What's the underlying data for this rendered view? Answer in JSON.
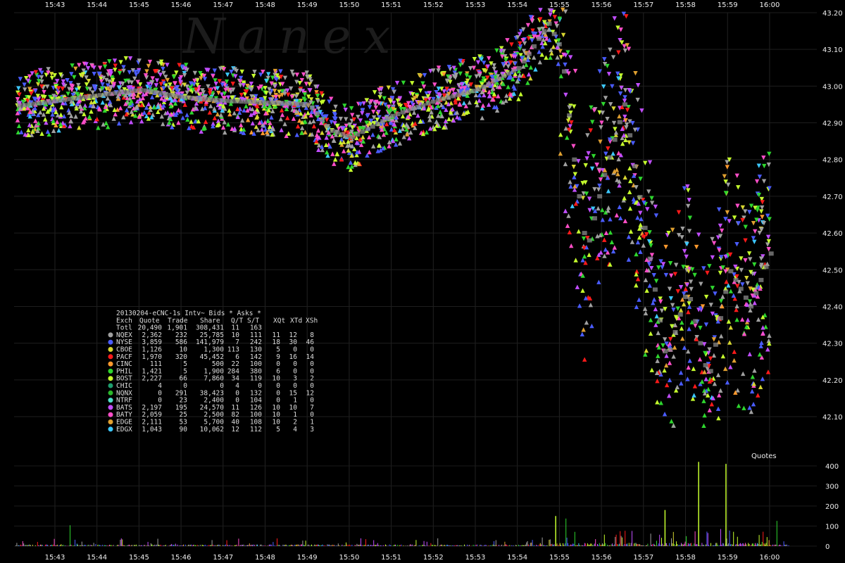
{
  "chart_data": {
    "type": "scatter",
    "title": "",
    "subtitle": "",
    "legend_title": "20130204-eCNC-1s Intv~ Bids * Asks *",
    "legend_placement": "left-center",
    "x_ticks": [
      "15:43",
      "15:44",
      "15:45",
      "15:46",
      "15:47",
      "15:48",
      "15:49",
      "15:50",
      "15:51",
      "15:52",
      "15:53",
      "15:54",
      "15:55",
      "15:56",
      "15:57",
      "15:58",
      "15:59",
      "16:00"
    ],
    "y_ticks": [
      "43.20",
      "43.10",
      "43.00",
      "42.90",
      "42.80",
      "42.70",
      "42.60",
      "42.50",
      "42.40",
      "42.30",
      "42.20",
      "42.10"
    ],
    "ylim": [
      42.04,
      43.21
    ],
    "volume_ticks": [
      "400",
      "300",
      "200",
      "100",
      "0"
    ],
    "volume_label": "Quotes",
    "watermark": "Nanex",
    "grid": true,
    "table_header": [
      "Exch",
      "Quote",
      "Trade",
      "Share",
      "Q/T",
      "S/T",
      "XQt",
      "XTd",
      "XSh"
    ],
    "table_rows": [
      {
        "exch": "Totl",
        "quote": "20,490",
        "trade": "1,901",
        "share": "308,431",
        "qt": "11",
        "st": "163",
        "xqt": "",
        "xtd": "",
        "xsh": "",
        "color": ""
      },
      {
        "exch": "NQEX",
        "quote": "2,362",
        "trade": "232",
        "share": "25,785",
        "qt": "10",
        "st": "111",
        "xqt": "11",
        "xtd": "12",
        "xsh": "8",
        "color": "#a0a0a0"
      },
      {
        "exch": "NYSE",
        "quote": "3,859",
        "trade": "586",
        "share": "141,979",
        "qt": "7",
        "st": "242",
        "xqt": "18",
        "xtd": "30",
        "xsh": "46",
        "color": "#4a5cff"
      },
      {
        "exch": "CBOE",
        "quote": "1,126",
        "trade": "10",
        "share": "1,300",
        "qt": "113",
        "st": "130",
        "xqt": "5",
        "xtd": "0",
        "xsh": "0",
        "color": "#d6d631"
      },
      {
        "exch": "PACF",
        "quote": "1,970",
        "trade": "320",
        "share": "45,452",
        "qt": "6",
        "st": "142",
        "xqt": "9",
        "xtd": "16",
        "xsh": "14",
        "color": "#ff1a1a"
      },
      {
        "exch": "CINC",
        "quote": "111",
        "trade": "5",
        "share": "500",
        "qt": "22",
        "st": "100",
        "xqt": "0",
        "xtd": "0",
        "xsh": "0",
        "color": "#ff9a2e"
      },
      {
        "exch": "PHIL",
        "quote": "1,421",
        "trade": "5",
        "share": "1,900",
        "qt": "284",
        "st": "380",
        "xqt": "6",
        "xtd": "0",
        "xsh": "0",
        "color": "#2ed62e"
      },
      {
        "exch": "BOST",
        "quote": "2,227",
        "trade": "66",
        "share": "7,860",
        "qt": "34",
        "st": "119",
        "xqt": "10",
        "xtd": "3",
        "xsh": "2",
        "color": "#c6ff2e"
      },
      {
        "exch": "CHIC",
        "quote": "4",
        "trade": "0",
        "share": "0",
        "qt": "4",
        "st": "0",
        "xqt": "0",
        "xtd": "0",
        "xsh": "0",
        "color": "#1e9e6e"
      },
      {
        "exch": "NQNX",
        "quote": "0",
        "trade": "291",
        "share": "38,423",
        "qt": "0",
        "st": "132",
        "xqt": "0",
        "xtd": "15",
        "xsh": "12",
        "color": "#2ab82a"
      },
      {
        "exch": "NTRF",
        "quote": "0",
        "trade": "23",
        "share": "2,400",
        "qt": "0",
        "st": "104",
        "xqt": "0",
        "xtd": "1",
        "xsh": "0",
        "color": "#4ee0c8"
      },
      {
        "exch": "BATS",
        "quote": "2,197",
        "trade": "195",
        "share": "24,570",
        "qt": "11",
        "st": "126",
        "xqt": "10",
        "xtd": "10",
        "xsh": "7",
        "color": "#c24eff"
      },
      {
        "exch": "BATY",
        "quote": "2,059",
        "trade": "25",
        "share": "2,500",
        "qt": "82",
        "st": "100",
        "xqt": "10",
        "xtd": "1",
        "xsh": "0",
        "color": "#ff4ec8"
      },
      {
        "exch": "EDGE",
        "quote": "2,111",
        "trade": "53",
        "share": "5,700",
        "qt": "40",
        "st": "108",
        "xqt": "10",
        "xtd": "2",
        "xsh": "1",
        "color": "#e0a030"
      },
      {
        "exch": "EDGX",
        "quote": "1,043",
        "trade": "90",
        "share": "10,062",
        "qt": "12",
        "st": "112",
        "xqt": "5",
        "xtd": "4",
        "xsh": "3",
        "color": "#3cc8ff"
      }
    ]
  }
}
